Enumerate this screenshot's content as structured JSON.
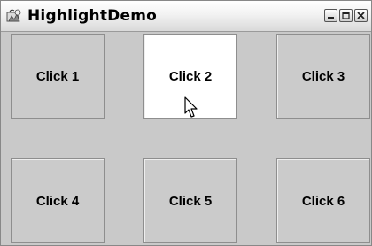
{
  "window": {
    "title": "HighlightDemo"
  },
  "buttons": [
    {
      "label": "Click 1",
      "highlighted": false
    },
    {
      "label": "Click 2",
      "highlighted": true
    },
    {
      "label": "Click 3",
      "highlighted": false
    },
    {
      "label": "Click 4",
      "highlighted": false
    },
    {
      "label": "Click 5",
      "highlighted": false
    },
    {
      "label": "Click 6",
      "highlighted": false
    }
  ],
  "colors": {
    "highlight": "#ffffff",
    "button_face": "#cbcbcb",
    "panel": "#c9c9c9"
  },
  "icons": [
    "app-icon",
    "minimize-icon",
    "maximize-icon",
    "close-icon",
    "mouse-pointer-icon"
  ]
}
